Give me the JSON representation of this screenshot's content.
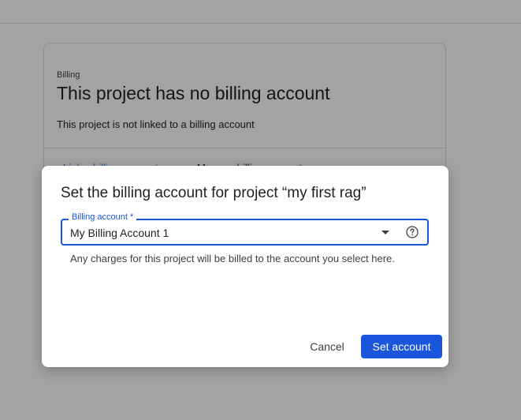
{
  "background": {
    "card": {
      "eyebrow": "Billing",
      "title": "This project has no billing account",
      "description": "This project is not linked to a billing account",
      "link_label": "Link a billing account",
      "manage_label": "Manage billing accounts"
    }
  },
  "dialog": {
    "title": "Set the billing account for project “my first rag”",
    "select": {
      "label": "Billing account *",
      "value": "My Billing Account 1",
      "dropdown_icon": "arrow-drop-down-icon",
      "help_icon": "help-circle-icon"
    },
    "helper_text": "Any charges for this project will be billed to the account you select here.",
    "cancel_label": "Cancel",
    "submit_label": "Set account"
  },
  "colors": {
    "primary": "#1a56db",
    "scrim": "rgba(0,0,0,0.36)",
    "text": "#202124"
  }
}
